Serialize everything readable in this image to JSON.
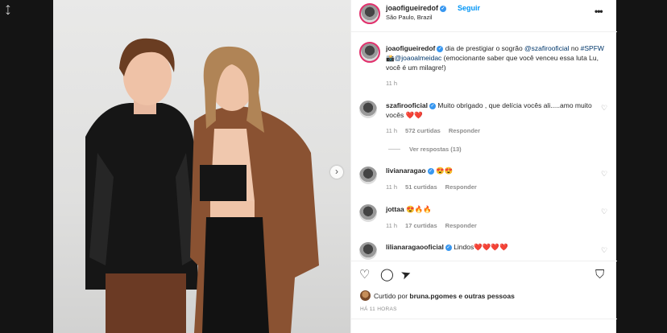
{
  "post": {
    "username": "joaofigueiredof",
    "follow_label": "Seguir",
    "location": "São Paulo, Brazil",
    "more_label": "•••",
    "caption": {
      "username": "joaofigueiredof",
      "text_1": " dia de prestigiar o sogrão ",
      "mention_1": "@szafirooficial",
      "text_2": " no ",
      "hashtag": "#SPFW",
      "text_3": " 📸",
      "mention_2": "@joaoalmeidac",
      "text_4": " (emocionante saber que você venceu essa luta Lu, você é um milagre!)",
      "time": "11 h"
    },
    "comments": [
      {
        "username": "szafirooficial",
        "text": "Muito obrigado , que delícia vocês ali.....amo muito vocês ❤️❤️",
        "time": "11 h",
        "likes": "572 curtidas",
        "reply": "Responder",
        "view_replies": "Ver respostas (13)"
      },
      {
        "username": "livianaragao",
        "text": "😍😍",
        "time": "11 h",
        "likes": "51 curtidas",
        "reply": "Responder"
      },
      {
        "username": "jottaa",
        "text": "😍🔥🔥",
        "time": "11 h",
        "likes": "17 curtidas",
        "reply": "Responder"
      },
      {
        "username": "lilianaragaooficial",
        "text": "Lindos❤️❤️❤️❤️"
      }
    ],
    "liked_by_prefix": "Curtido por ",
    "liked_by_user": "bruna.pgomes",
    "liked_by_suffix": " e outras pessoas",
    "time_ago": "HÁ 11 HORAS"
  },
  "icons": {
    "expand": "expand-icon",
    "next": "chevron-right-icon",
    "heart": "heart-icon",
    "comment": "comment-icon",
    "share": "share-icon",
    "save": "bookmark-icon"
  },
  "colors": {
    "link": "#00376b",
    "follow": "#0095f6",
    "verified": "#3897f0"
  }
}
